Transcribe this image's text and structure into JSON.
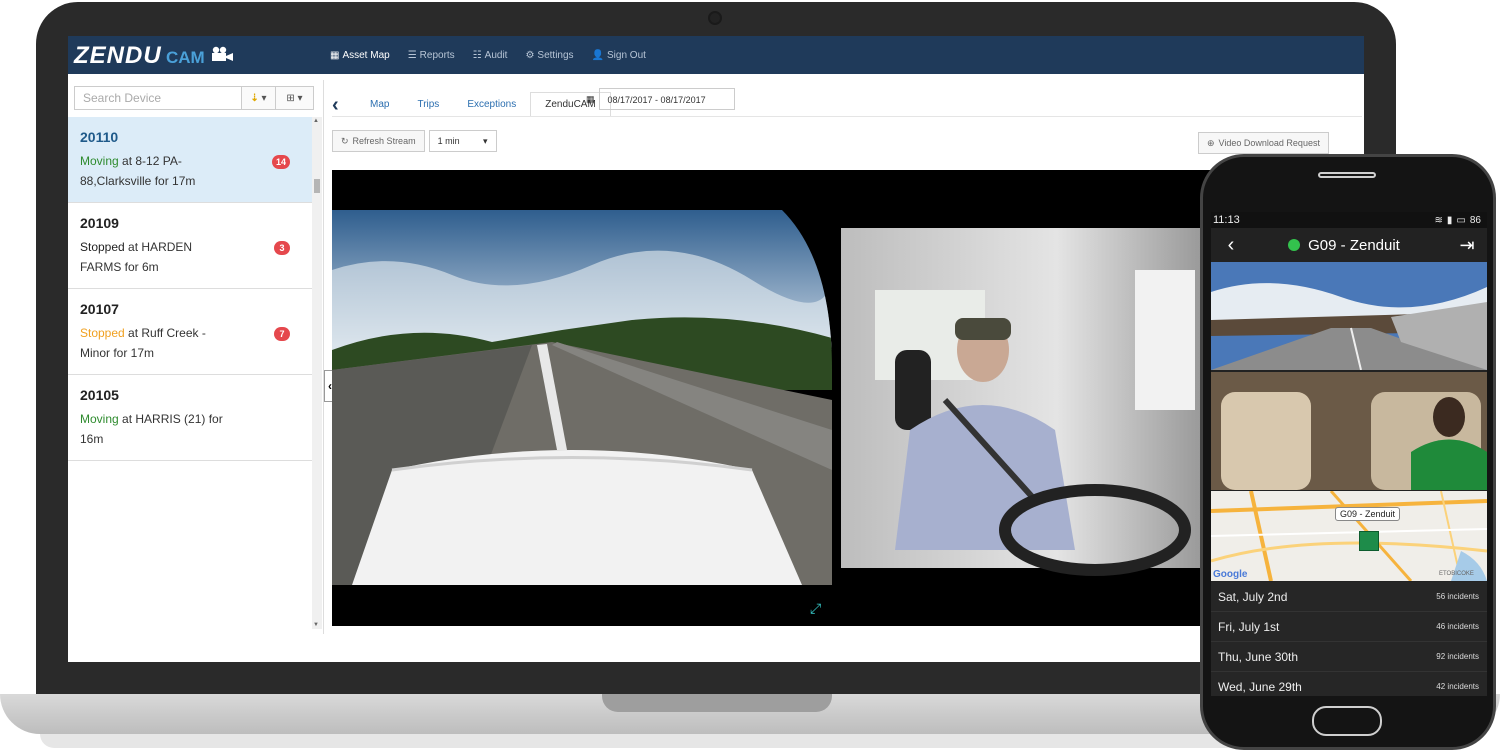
{
  "app": {
    "logo_main": "ZENDU",
    "logo_sub": "CAM"
  },
  "nav": [
    {
      "icon": "▦",
      "label": "Asset Map",
      "active": true
    },
    {
      "icon": "☰",
      "label": "Reports",
      "active": false
    },
    {
      "icon": "☷",
      "label": "Audit",
      "active": false
    },
    {
      "icon": "⚙",
      "label": "Settings",
      "active": false
    },
    {
      "icon": "👤",
      "label": "Sign Out",
      "active": false
    }
  ],
  "sidebar": {
    "search_placeholder": "Search Device",
    "devices": [
      {
        "id": "20110",
        "status_word": "Moving",
        "status_class": "st-moving",
        "rest": " at 8-12 PA-88,Clarksville for 17m",
        "badge": "14",
        "selected": true
      },
      {
        "id": "20109",
        "status_word": "Stopped",
        "status_class": "st-stopped",
        "rest": " at HARDEN FARMS for 6m",
        "badge": "3",
        "selected": false
      },
      {
        "id": "20107",
        "status_word": "Stopped",
        "status_class": "st-warn",
        "rest": " at Ruff Creek - Minor for 17m",
        "badge": "7",
        "selected": false
      },
      {
        "id": "20105",
        "status_word": "Moving",
        "status_class": "st-moving",
        "rest": " at HARRIS (21) for 16m",
        "badge": "",
        "selected": false
      }
    ]
  },
  "content": {
    "tabs": [
      "Map",
      "Trips",
      "Exceptions",
      "ZenduCAM"
    ],
    "active_tab": "ZenduCAM",
    "date_range": "08/17/2017 - 08/17/2017",
    "refresh_label": "Refresh Stream",
    "interval_value": "1 min",
    "video_request_label": "Video Download Request"
  },
  "phone": {
    "time": "11:13",
    "battery": "86",
    "vehicle_title": "G09 - Zenduit",
    "map_label": "G09 - Zenduit",
    "map_brand": "Google",
    "map_place": "ETOBICOKE",
    "days": [
      {
        "date": "Sat, July 2nd",
        "incidents": "56 incidents"
      },
      {
        "date": "Fri, July 1st",
        "incidents": "46 incidents"
      },
      {
        "date": "Thu, June 30th",
        "incidents": "92 incidents"
      },
      {
        "date": "Wed, June 29th",
        "incidents": "42 incidents"
      }
    ]
  },
  "colors": {
    "nav_bg": "#1f3a5a",
    "selected_row": "#dcecf8",
    "badge": "#e5484d",
    "moving": "#2e8b2e",
    "warning": "#f0a020",
    "online_dot": "#33c24d"
  }
}
